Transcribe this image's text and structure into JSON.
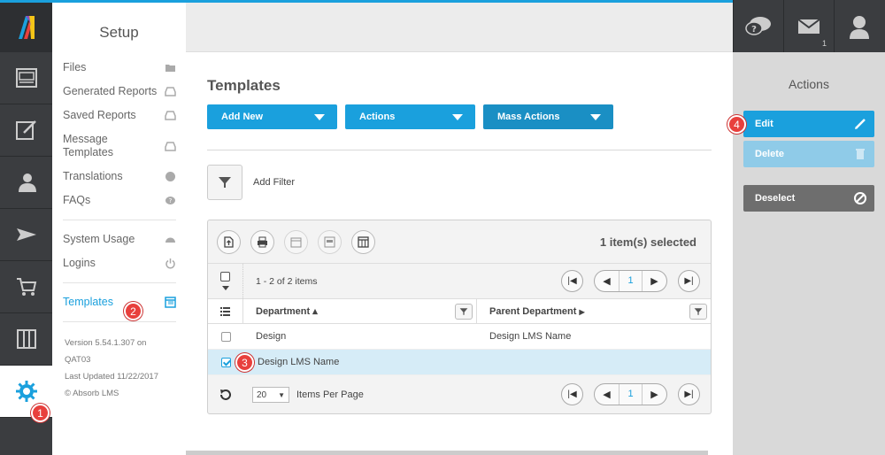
{
  "setup": {
    "title": "Setup",
    "group1": [
      {
        "label": "Files",
        "icon": "folder-icon"
      },
      {
        "label": "Generated Reports",
        "icon": "inbox-icon"
      },
      {
        "label": "Saved Reports",
        "icon": "inbox-icon"
      },
      {
        "label": "Message Templates",
        "icon": "inbox-icon"
      },
      {
        "label": "Translations",
        "icon": "globe-icon"
      },
      {
        "label": "FAQs",
        "icon": "help-icon"
      }
    ],
    "group2": [
      {
        "label": "System Usage",
        "icon": "gauge-icon"
      },
      {
        "label": "Logins",
        "icon": "power-icon"
      }
    ],
    "active": {
      "label": "Templates",
      "icon": "template-icon"
    },
    "version": "Version 5.54.1.307 on QAT03",
    "updated": "Last Updated 11/22/2017",
    "copyright": "© Absorb LMS"
  },
  "main": {
    "title": "Templates",
    "add_new": "Add New",
    "actions": "Actions",
    "mass_actions": "Mass Actions",
    "add_filter": "Add Filter",
    "selected_text": "1 item(s) selected",
    "items_count": "1 - 2 of 2 items",
    "page": "1",
    "columns": [
      "Department",
      "Parent Department"
    ],
    "rows": [
      {
        "department": "Design",
        "parent": "Design LMS Name",
        "selected": false
      },
      {
        "department": "Design LMS Name",
        "parent": "",
        "selected": true
      }
    ],
    "per_page_value": "20",
    "per_page_label": "Items Per Page"
  },
  "actions_panel": {
    "title": "Actions",
    "edit": "Edit",
    "delete": "Delete",
    "deselect": "Deselect"
  },
  "header": {
    "messages_count": "1"
  },
  "callouts": [
    "1",
    "2",
    "3",
    "4"
  ],
  "colors": {
    "accent": "#1aa0dd",
    "dark_blue": "#1a8fc4",
    "rail": "#3b3d40",
    "callout": "#e8403d"
  }
}
